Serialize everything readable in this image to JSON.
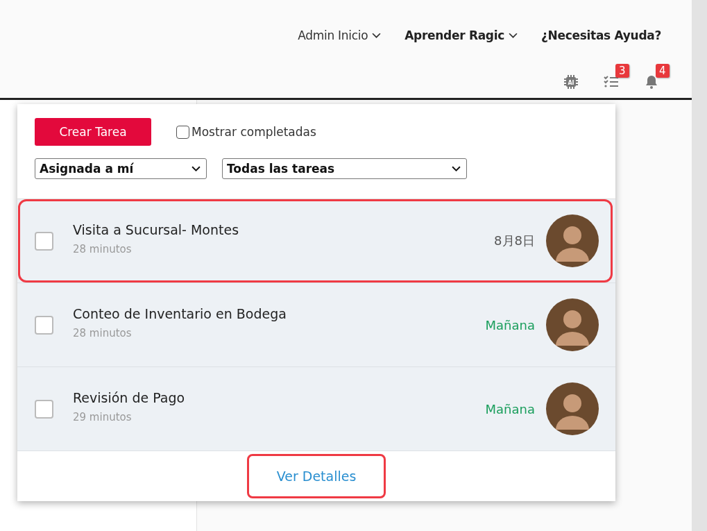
{
  "nav": [
    {
      "label": "Admin Inicio",
      "bold": false,
      "dropdown": true
    },
    {
      "label": "Aprender Ragic",
      "bold": true,
      "dropdown": true
    },
    {
      "label": "¿Necesitas Ayuda?",
      "bold": true,
      "dropdown": false
    }
  ],
  "toolbar": [
    {
      "kind": "ai",
      "label": "AI"
    },
    {
      "kind": "tasks",
      "badge": "3"
    },
    {
      "kind": "bell",
      "badge": "4"
    }
  ],
  "panel": {
    "create_button": "Crear Tarea",
    "show_completed": {
      "label": "Mostrar completadas",
      "checked": false
    },
    "filters": [
      {
        "value": "Asignada a mí"
      },
      {
        "value": "Todas las tareas"
      }
    ],
    "tasks": [
      {
        "title": "Visita a Sucursal- Montes",
        "age": "28 minutos",
        "due": "8月8日",
        "color": "#555555",
        "checked": false,
        "highlighted": true
      },
      {
        "title": "Conteo de Inventario en Bodega",
        "age": "28 minutos",
        "due": "Mañana",
        "color": "#1a9e5c",
        "checked": false,
        "highlighted": false
      },
      {
        "title": "Revisión de Pago",
        "age": "29 minutos",
        "due": "Mañana",
        "color": "#1a9e5c",
        "checked": false,
        "highlighted": false
      }
    ],
    "details_link": {
      "label": "Ver Detalles",
      "highlighted": true
    }
  }
}
